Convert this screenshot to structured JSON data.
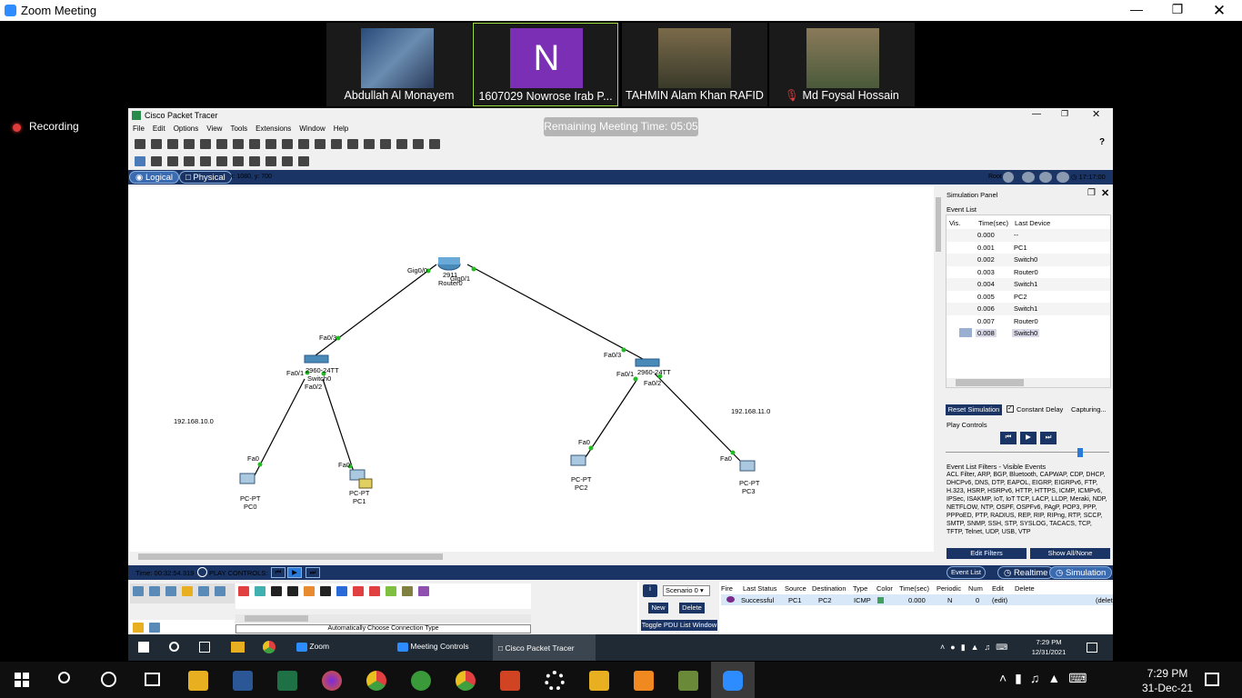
{
  "zoom": {
    "title": "Zoom Meeting",
    "recording": "Recording"
  },
  "participants": [
    {
      "name": "Abdullah Al Monayem",
      "thumb_color": "#3a5f8c"
    },
    {
      "name": "1607029 Nowrose Irab P...",
      "thumb_color": "#7b2fb5",
      "initial": "N"
    },
    {
      "name": "TAHMIN Alam Khan RAFID",
      "thumb_color": "#5a4a3a"
    },
    {
      "name": "Md Foysal Hossain",
      "thumb_color": "#6b5b4b"
    }
  ],
  "pt": {
    "title": "Cisco Packet Tracer",
    "menu": [
      "File",
      "Edit",
      "Options",
      "View",
      "Tools",
      "Extensions",
      "Window",
      "Help"
    ],
    "remaining_time": "Remaining Meeting Time: 05:05",
    "logical_label": "Logical",
    "physical_label": "Physical",
    "coords": "x: 1080, y: 700",
    "root_label": "Root",
    "clock": "17:17:00",
    "network": {
      "router": {
        "model": "2911",
        "name": "Router0",
        "left_port": "Gig0/0",
        "right_port": "Gig0/1"
      },
      "switch0": {
        "model": "2960-24TT",
        "name": "Switch0",
        "up": "Fa0/3",
        "p1": "Fa0/1",
        "p2": "Fa0/2"
      },
      "switch1": {
        "model": "2960-24TT",
        "name": "Switch1",
        "up": "Fa0/3",
        "p1": "Fa0/1",
        "p2": "Fa0/2"
      },
      "pcs": [
        {
          "type": "PC-PT",
          "name": "PC0",
          "port": "Fa0"
        },
        {
          "type": "PC-PT",
          "name": "PC1",
          "port": "Fa0"
        },
        {
          "type": "PC-PT",
          "name": "PC2",
          "port": "Fa0"
        },
        {
          "type": "PC-PT",
          "name": "PC3",
          "port": "Fa0"
        }
      ],
      "net_left": "192.168.10.0",
      "net_right": "192.168.11.0"
    },
    "sim": {
      "title": "Simulation Panel",
      "event_list": "Event List",
      "headers": {
        "vis": "Vis.",
        "time": "Time(sec)",
        "device": "Last Device"
      },
      "events": [
        {
          "time": "0.000",
          "device": "--"
        },
        {
          "time": "0.001",
          "device": "PC1"
        },
        {
          "time": "0.002",
          "device": "Switch0"
        },
        {
          "time": "0.003",
          "device": "Router0"
        },
        {
          "time": "0.004",
          "device": "Switch1"
        },
        {
          "time": "0.005",
          "device": "PC2"
        },
        {
          "time": "0.006",
          "device": "Switch1"
        },
        {
          "time": "0.007",
          "device": "Router0"
        },
        {
          "time": "0.008",
          "device": "Switch0"
        }
      ],
      "reset": "Reset Simulation",
      "constant_delay": "Constant Delay",
      "capturing": "Capturing...",
      "play_controls": "Play Controls",
      "filters_title": "Event List Filters - Visible Events",
      "filters": "ACL Filter, ARP, BGP, Bluetooth, CAPWAP, CDP, DHCP, DHCPv6, DNS, DTP, EAPOL, EIGRP, EIGRPv6, FTP, H.323, HSRP, HSRPv6, HTTP, HTTPS, ICMP, ICMPv6, IPSec, ISAKMP, IoT, IoT TCP, LACP, LLDP, Meraki, NDP, NETFLOW, NTP, OSPF, OSPFv6, PAgP, POP3, PPP, PPPoED, PTP, RADIUS, REP, RIP, RIPng, RTP, SCCP, SMTP, SNMP, SSH, STP, SYSLOG, TACACS, TCP, TFTP, Telnet, UDP, USB, VTP",
      "edit_filters": "Edit Filters",
      "show_all": "Show All/None"
    },
    "time_label": "Time: 00:32:54.319",
    "play_label": "PLAY CONTROLS:",
    "modes": {
      "event_list": "Event List",
      "realtime": "Realtime",
      "simulation": "Simulation"
    },
    "conn_type": "Automatically Choose Connection Type",
    "scenario": "Scenario 0",
    "new": "New",
    "delete": "Delete",
    "toggle": "Toggle PDU List Window",
    "pdu_headers": [
      "Fire",
      "Last Status",
      "Source",
      "Destination",
      "Type",
      "Color",
      "Time(sec)",
      "Periodic",
      "Num",
      "Edit",
      "Delete"
    ],
    "pdu_row": {
      "status": "Successful",
      "source": "PC1",
      "dest": "PC2",
      "type": "ICMP",
      "time": "0.000",
      "periodic": "N",
      "num": "0",
      "edit": "(edit)",
      "delete": "(delete)"
    },
    "itask": {
      "zoom": "Zoom",
      "meeting": "Meeting Controls",
      "pt": "Cisco Packet Tracer",
      "time": "7:29 PM",
      "date": "12/31/2021"
    }
  },
  "taskbar": {
    "time": "7:29 PM",
    "date": "31-Dec-21"
  }
}
